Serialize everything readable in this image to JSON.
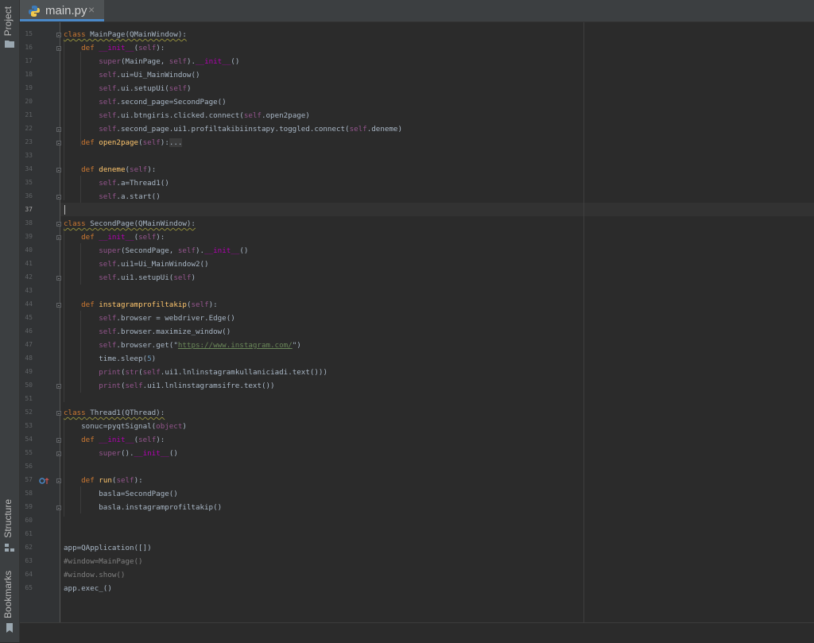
{
  "sidebar": {
    "project_label": "Project",
    "structure_label": "Structure",
    "bookmarks_label": "Bookmarks"
  },
  "tab": {
    "title": "main.py",
    "close_label": "×"
  },
  "editor": {
    "current_line": "37",
    "lines": [
      {
        "n": "15",
        "text": "class MainPage(QMainWindow):"
      },
      {
        "n": "16",
        "text": "    def __init__(self):"
      },
      {
        "n": "17",
        "text": "        super(MainPage, self).__init__()"
      },
      {
        "n": "18",
        "text": "        self.ui=Ui_MainWindow()"
      },
      {
        "n": "19",
        "text": "        self.ui.setupUi(self)"
      },
      {
        "n": "20",
        "text": "        self.second_page=SecondPage()"
      },
      {
        "n": "21",
        "text": "        self.ui.btngiris.clicked.connect(self.open2page)"
      },
      {
        "n": "22",
        "text": "        self.second_page.ui1.profiltakibiinstapy.toggled.connect(self.deneme)"
      },
      {
        "n": "23",
        "text": "    def open2page(self):..."
      },
      {
        "n": "33",
        "text": ""
      },
      {
        "n": "34",
        "text": "    def deneme(self):"
      },
      {
        "n": "35",
        "text": "        self.a=Thread1()"
      },
      {
        "n": "36",
        "text": "        self.a.start()"
      },
      {
        "n": "37",
        "text": ""
      },
      {
        "n": "38",
        "text": "class SecondPage(QMainWindow):"
      },
      {
        "n": "39",
        "text": "    def __init__(self):"
      },
      {
        "n": "40",
        "text": "        super(SecondPage, self).__init__()"
      },
      {
        "n": "41",
        "text": "        self.ui1=Ui_MainWindow2()"
      },
      {
        "n": "42",
        "text": "        self.ui1.setupUi(self)"
      },
      {
        "n": "43",
        "text": ""
      },
      {
        "n": "44",
        "text": "    def instagramprofiltakip(self):"
      },
      {
        "n": "45",
        "text": "        self.browser = webdriver.Edge()"
      },
      {
        "n": "46",
        "text": "        self.browser.maximize_window()"
      },
      {
        "n": "47",
        "text": "        self.browser.get(\"https://www.instagram.com/\")"
      },
      {
        "n": "48",
        "text": "        time.sleep(5)"
      },
      {
        "n": "49",
        "text": "        print(str(self.ui1.lnlinstagramkullaniciadi.text()))"
      },
      {
        "n": "50",
        "text": "        print(self.ui1.lnlinstagramsifre.text())"
      },
      {
        "n": "51",
        "text": ""
      },
      {
        "n": "52",
        "text": "class Thread1(QThread):"
      },
      {
        "n": "53",
        "text": "    sonuc=pyqtSignal(object)"
      },
      {
        "n": "54",
        "text": "    def __init__(self):"
      },
      {
        "n": "55",
        "text": "        super().__init__()"
      },
      {
        "n": "56",
        "text": ""
      },
      {
        "n": "57",
        "text": "    def run(self):"
      },
      {
        "n": "58",
        "text": "        basla=SecondPage()"
      },
      {
        "n": "59",
        "text": "        basla.instagramprofiltakip()"
      },
      {
        "n": "60",
        "text": ""
      },
      {
        "n": "61",
        "text": ""
      },
      {
        "n": "62",
        "text": "app=QApplication([])"
      },
      {
        "n": "63",
        "text": "#window=MainPage()"
      },
      {
        "n": "64",
        "text": "#window.show()"
      },
      {
        "n": "65",
        "text": "app.exec_()"
      }
    ]
  }
}
